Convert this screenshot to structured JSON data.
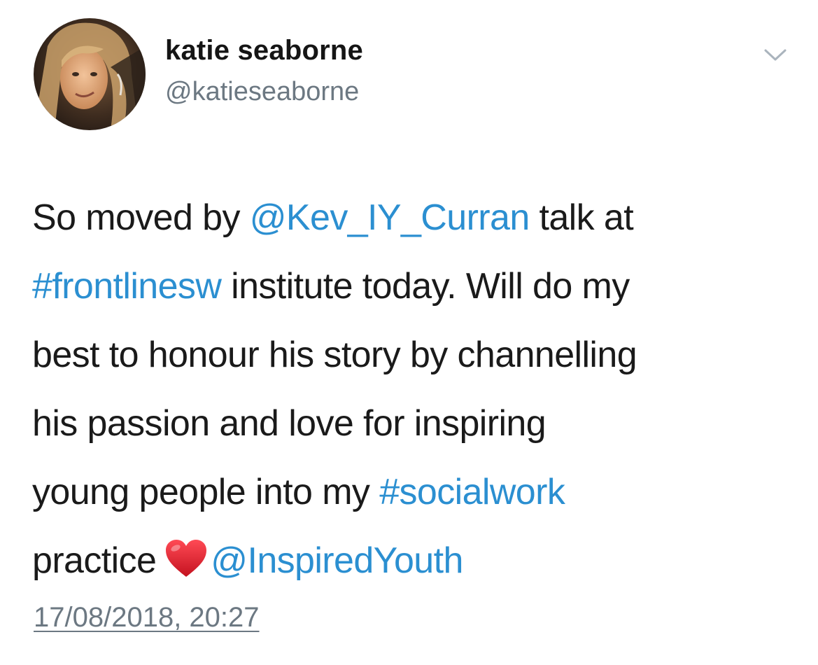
{
  "author": {
    "display_name": "katie seaborne",
    "handle": "@katieseaborne"
  },
  "menu": {
    "icon": "chevron-down-icon"
  },
  "tweet": {
    "line1": {
      "t1": "So moved by ",
      "mention1": "@Kev_IY_Curran",
      "t2": " talk at"
    },
    "line2": {
      "hashtag1": "#frontlinesw",
      "t1": " institute today. Will do my"
    },
    "line3": {
      "t1": "best to honour his story by channelling"
    },
    "line4": {
      "t1": "his passion and love for inspiring"
    },
    "line5": {
      "t1": "young people into my ",
      "hashtag2": "#socialwork"
    },
    "line6": {
      "t1": "practice",
      "emoji": "heart-emoji",
      "mention2": "@InspiredYouth"
    }
  },
  "timestamp": "17/08/2018, 20:27",
  "colors": {
    "link": "#2b8fd1",
    "secondary_text": "#6c7882",
    "primary_text": "#1a1a1a",
    "heart": "#e0192b"
  }
}
